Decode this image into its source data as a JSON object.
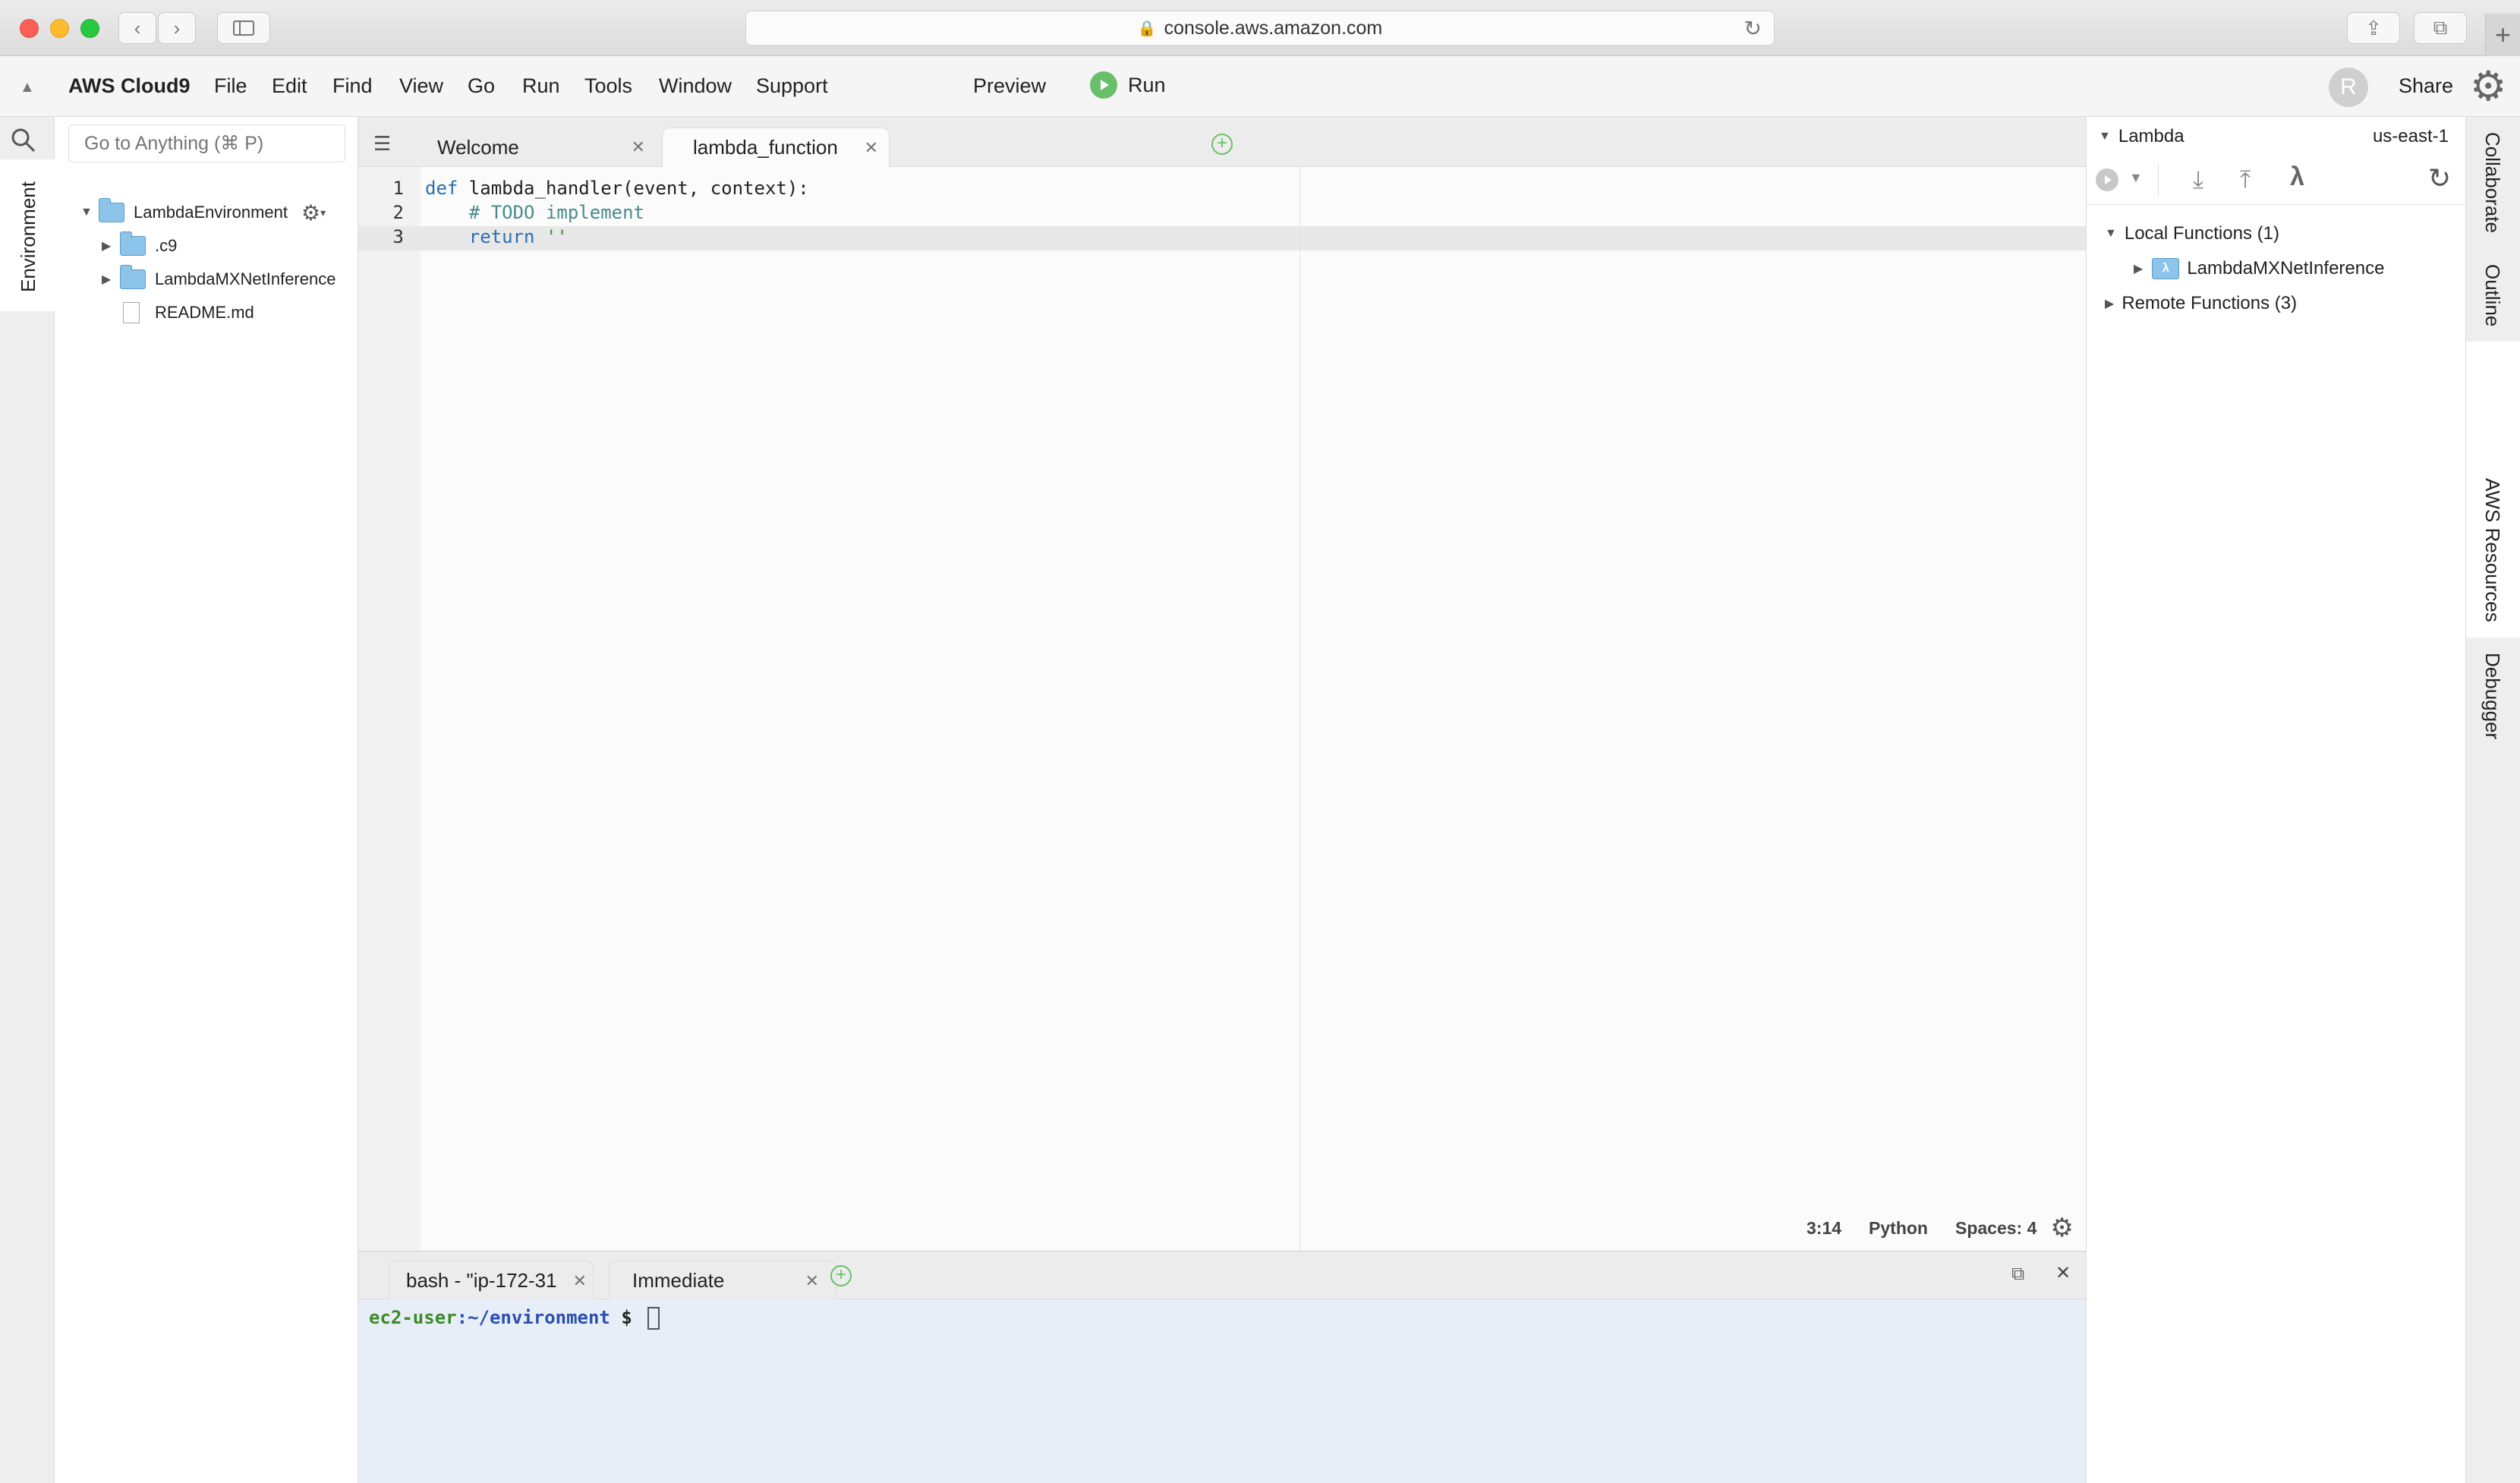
{
  "browser": {
    "url": "console.aws.amazon.com",
    "nav_back": "‹",
    "nav_forward": "›"
  },
  "menubar": {
    "brand": "AWS Cloud9",
    "items": [
      "File",
      "Edit",
      "Find",
      "View",
      "Go",
      "Run",
      "Tools",
      "Window",
      "Support"
    ],
    "preview": "Preview",
    "run": "Run",
    "avatar_initial": "R",
    "share": "Share"
  },
  "left_sidebar": {
    "tab": "Environment",
    "search_placeholder": "Go to Anything (⌘ P)",
    "tree": {
      "root": "LambdaEnvironment",
      "children": [
        ".c9",
        "LambdaMXNetInference",
        "README.md"
      ]
    }
  },
  "editor": {
    "tabs": [
      "Welcome",
      "lambda_function"
    ],
    "line_numbers": [
      "1",
      "2",
      "3"
    ],
    "code": {
      "l1_kw": "def",
      "l1_rest": " lambda_handler(event, context):",
      "l2": "    # TODO implement",
      "l3_indent": "    ",
      "l3_kw": "return",
      "l3_str": " ''"
    },
    "status": {
      "position": "3:14",
      "language": "Python",
      "spaces": "Spaces: 4"
    }
  },
  "terminal": {
    "tabs": [
      "bash - \"ip-172-31",
      "Immediate"
    ],
    "prompt_user": "ec2-user",
    "prompt_path": ":~/environment",
    "prompt_symbol": " $ "
  },
  "right_panel": {
    "title": "Lambda",
    "region": "us-east-1",
    "local_functions": "Local Functions (1)",
    "local_function_item": "LambdaMXNetInference",
    "remote_functions": "Remote Functions (3)",
    "side_tabs": [
      "Collaborate",
      "Outline",
      "AWS Resources",
      "Debugger"
    ]
  },
  "colors": {
    "run_green": "#6abf69",
    "folder_blue": "#8cc4ea",
    "keyword_blue": "#2a6fb0",
    "terminal_bg": "#e8eef7"
  }
}
